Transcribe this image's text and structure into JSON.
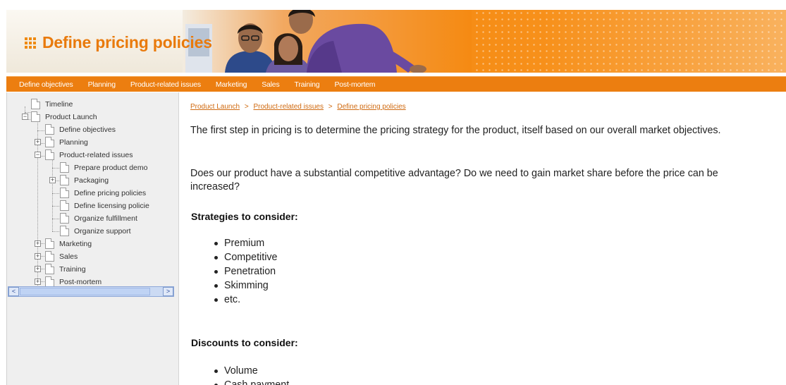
{
  "header": {
    "title": "Define pricing policies",
    "icon": "grid-icon",
    "accent_color": "#ec7e10"
  },
  "nav": {
    "items": [
      "Define objectives",
      "Planning",
      "Product-related issues",
      "Marketing",
      "Sales",
      "Training",
      "Post-mortem"
    ]
  },
  "sidebar": {
    "tree": [
      {
        "label": "Timeline",
        "expander": ""
      },
      {
        "label": "Product Launch",
        "expander": "−"
      },
      {
        "label": "Define objectives",
        "expander": ""
      },
      {
        "label": "Planning",
        "expander": "+"
      },
      {
        "label": "Product-related issues",
        "expander": "−"
      },
      {
        "label": "Prepare product demo",
        "expander": ""
      },
      {
        "label": "Packaging",
        "expander": "+"
      },
      {
        "label": "Define pricing policies",
        "expander": ""
      },
      {
        "label": "Define licensing policie",
        "expander": ""
      },
      {
        "label": "Organize fulfillment",
        "expander": ""
      },
      {
        "label": "Organize support",
        "expander": ""
      },
      {
        "label": "Marketing",
        "expander": "+"
      },
      {
        "label": "Sales",
        "expander": "+"
      },
      {
        "label": "Training",
        "expander": "+"
      },
      {
        "label": "Post-mortem",
        "expander": "+"
      }
    ],
    "scroll_left": "<",
    "scroll_right": ">"
  },
  "main": {
    "breadcrumb": [
      "Product Launch",
      "Product-related issues",
      "Define pricing policies"
    ],
    "breadcrumb_sep": ">",
    "intro_1": "The first step in pricing is to determine the pricing strategy for the product, itself based on our overall market objectives.",
    "intro_2": "Does our product have a substantial competitive advantage? Do we need to gain market share before the price can be increased?",
    "strategies_heading": "Strategies to consider:",
    "strategies": [
      "Premium",
      "Competitive",
      "Penetration",
      "Skimming",
      "etc."
    ],
    "discounts_heading": "Discounts to consider:",
    "discounts": [
      "Volume",
      "Cash payment"
    ]
  }
}
